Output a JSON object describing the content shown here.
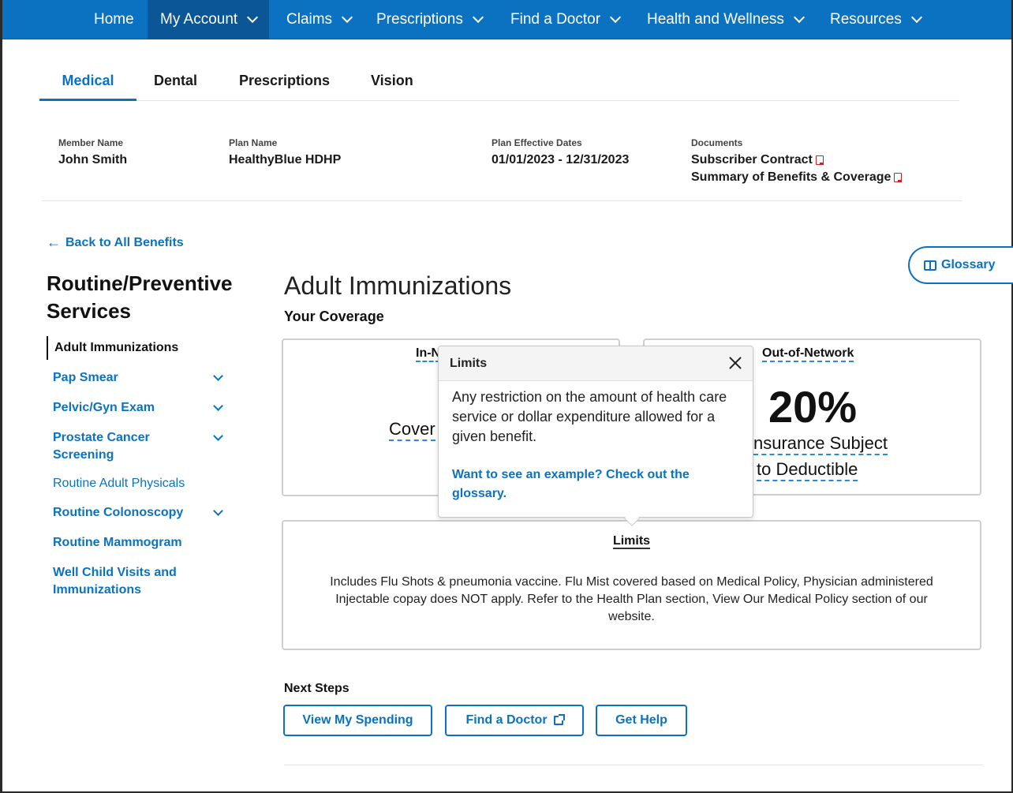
{
  "nav": {
    "items": [
      {
        "label": "Home",
        "has_menu": false
      },
      {
        "label": "My Account",
        "has_menu": true,
        "active": true
      },
      {
        "label": "Claims",
        "has_menu": true
      },
      {
        "label": "Prescriptions",
        "has_menu": true
      },
      {
        "label": "Find a Doctor",
        "has_menu": true
      },
      {
        "label": "Health and Wellness",
        "has_menu": true
      },
      {
        "label": "Resources",
        "has_menu": true
      }
    ]
  },
  "tabs": [
    {
      "label": "Medical",
      "active": true
    },
    {
      "label": "Dental"
    },
    {
      "label": "Prescriptions"
    },
    {
      "label": "Vision"
    }
  ],
  "member": {
    "name_label": "Member Name",
    "name": "John Smith",
    "plan_label": "Plan Name",
    "plan": "HealthyBlue HDHP",
    "dates_label": "Plan Effective Dates",
    "dates": "01/01/2023 - 12/31/2023",
    "docs_label": "Documents",
    "docs": [
      "Subscriber Contract",
      "Summary of Benefits & Coverage"
    ]
  },
  "back_link": "Back to All Benefits",
  "glossary_label": "Glossary",
  "sidebar": {
    "title": "Routine/Preventive Services",
    "items": [
      {
        "label": "Adult Immunizations",
        "current": true
      },
      {
        "label": "Pap Smear",
        "expandable": true
      },
      {
        "label": "Pelvic/Gyn Exam",
        "expandable": true
      },
      {
        "label": "Prostate Cancer Screening",
        "expandable": true
      },
      {
        "label": "Routine Adult Physicals"
      },
      {
        "label": "Routine Colonoscopy",
        "expandable": true
      },
      {
        "label": "Routine Mammogram"
      },
      {
        "label": "Well Child Visits and Immunizations"
      }
    ]
  },
  "main": {
    "title": "Adult Immunizations",
    "coverage_label": "Your Coverage",
    "in_network": {
      "head": "In-N",
      "sub": "Cover"
    },
    "out_network": {
      "head": "Out-of-Network",
      "big": "20%",
      "sub1": "nsurance Subject",
      "sub2": "to Deductible"
    },
    "limits_head": "Limits",
    "limits_text": "Includes Flu Shots & pneumonia vaccine. Flu Mist covered based on Medical Policy, Physician administered Injectable copay does NOT apply. Refer to the Health Plan section, View Our Medical Policy section of our website."
  },
  "popup": {
    "title": "Limits",
    "body": "Any restriction on the amount of health care service or dollar expenditure allowed for a given benefit.",
    "link": "Want to see an example? Check out the glossary."
  },
  "next_steps": {
    "label": "Next Steps",
    "buttons": [
      "View My Spending",
      "Find a Doctor",
      "Get Help"
    ]
  },
  "colors": {
    "brand": "#0b72c2",
    "nav_active": "#0a5696",
    "pdf": "#d02020"
  }
}
